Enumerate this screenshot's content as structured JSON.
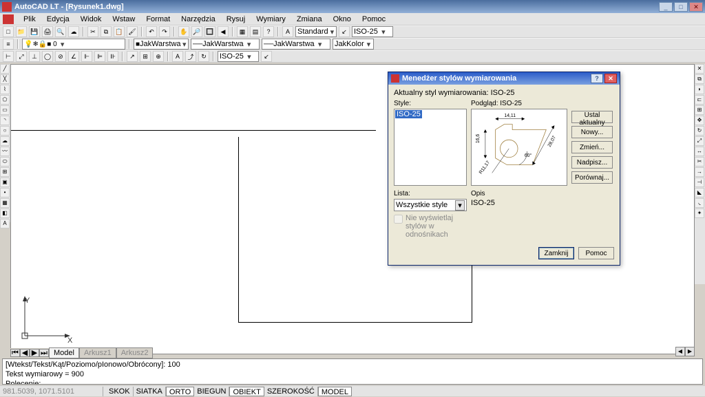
{
  "window": {
    "title": "AutoCAD LT - [Rysunek1.dwg]"
  },
  "menu": {
    "items": [
      "Plik",
      "Edycja",
      "Widok",
      "Wstaw",
      "Format",
      "Narzędzia",
      "Rysuj",
      "Wymiary",
      "Zmiana",
      "Okno",
      "Pomoc"
    ]
  },
  "toolbar1": {
    "textstyle": "Standard",
    "dimstyle": "ISO-25"
  },
  "toolbar2": {
    "layer": "JakWarstwa",
    "ltype": "JakWarstwa",
    "lweight": "JakWarstwa",
    "color": "JakKolor"
  },
  "toolbar3": {
    "dimstyle": "ISO-25"
  },
  "tabs": {
    "model": "Model",
    "layout1": "Arkusz1",
    "layout2": "Arkusz2"
  },
  "cmd": {
    "line1": "[Wtekst/Tekst/Kąt/Poziomo/pIonowo/Obrócony]: 100",
    "line2": "Tekst wymiarowy = 900",
    "line3": "Polecenie:"
  },
  "status": {
    "coords": "981.5039, 1071.5101",
    "toggles": [
      "SKOK",
      "SIATKA",
      "ORTO",
      "BIEGUN",
      "OBIEKT",
      "SZEROKOŚĆ",
      "MODEL"
    ]
  },
  "dialog": {
    "title": "Menedżer stylów wymiarowania",
    "current_label": "Aktualny styl wymiarowania: ISO-25",
    "styles_label": "Style:",
    "styles_items": [
      "ISO-25"
    ],
    "preview_label": "Podgląd: ISO-25",
    "preview_dims": {
      "top": "14,11",
      "left": "16,6",
      "bottomleft": "R11,17",
      "angle": "60°",
      "right": "28,07"
    },
    "list_label": "Lista:",
    "list_value": "Wszystkie style",
    "checkbox_label": "Nie wyświetlaj stylów w odnośnikach",
    "opis_label": "Opis",
    "opis_value": "ISO-25",
    "buttons": {
      "set_current": "Ustal aktualny",
      "new": "Nowy...",
      "modify": "Zmień...",
      "override": "Nadpisz...",
      "compare": "Porównaj..."
    },
    "footer": {
      "close": "Zamknij",
      "help": "Pomoc"
    }
  },
  "ucs": {
    "x": "X",
    "y": "Y"
  }
}
